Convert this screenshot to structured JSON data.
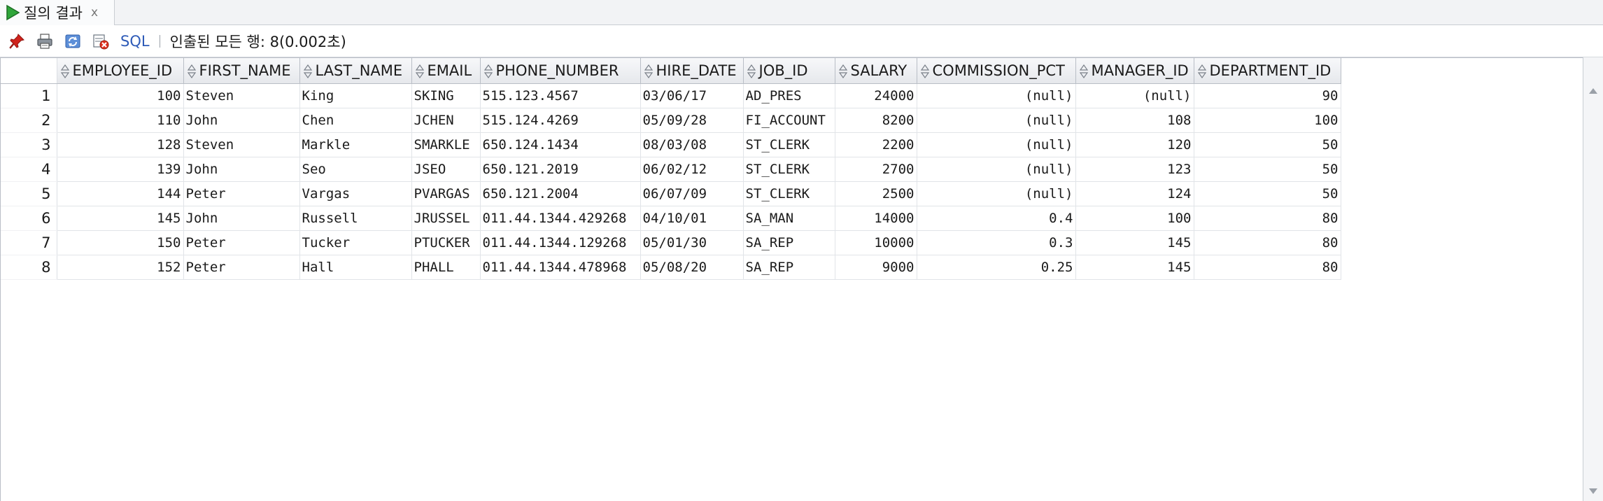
{
  "tab": {
    "label": "질의 결과",
    "close": "x",
    "icon": "run-icon"
  },
  "toolbar": {
    "icons": [
      "pin-icon",
      "print-icon",
      "refresh-icon",
      "cancel-icon"
    ],
    "sql_label": "SQL",
    "status": "인출된 모든 행: 8(0.002초)"
  },
  "grid": {
    "columns": [
      {
        "label": "EMPLOYEE_ID",
        "align": "num"
      },
      {
        "label": "FIRST_NAME",
        "align": "txt"
      },
      {
        "label": "LAST_NAME",
        "align": "txt"
      },
      {
        "label": "EMAIL",
        "align": "txt"
      },
      {
        "label": "PHONE_NUMBER",
        "align": "txt"
      },
      {
        "label": "HIRE_DATE",
        "align": "txt"
      },
      {
        "label": "JOB_ID",
        "align": "txt"
      },
      {
        "label": "SALARY",
        "align": "num"
      },
      {
        "label": "COMMISSION_PCT",
        "align": "num"
      },
      {
        "label": "MANAGER_ID",
        "align": "num"
      },
      {
        "label": "DEPARTMENT_ID",
        "align": "num"
      }
    ],
    "rows": [
      {
        "n": "1",
        "cells": [
          "100",
          "Steven",
          "King",
          "SKING",
          "515.123.4567",
          "03/06/17",
          "AD_PRES",
          "24000",
          "(null)",
          "(null)",
          "90"
        ]
      },
      {
        "n": "2",
        "cells": [
          "110",
          "John",
          "Chen",
          "JCHEN",
          "515.124.4269",
          "05/09/28",
          "FI_ACCOUNT",
          "8200",
          "(null)",
          "108",
          "100"
        ]
      },
      {
        "n": "3",
        "cells": [
          "128",
          "Steven",
          "Markle",
          "SMARKLE",
          "650.124.1434",
          "08/03/08",
          "ST_CLERK",
          "2200",
          "(null)",
          "120",
          "50"
        ]
      },
      {
        "n": "4",
        "cells": [
          "139",
          "John",
          "Seo",
          "JSEO",
          "650.121.2019",
          "06/02/12",
          "ST_CLERK",
          "2700",
          "(null)",
          "123",
          "50"
        ]
      },
      {
        "n": "5",
        "cells": [
          "144",
          "Peter",
          "Vargas",
          "PVARGAS",
          "650.121.2004",
          "06/07/09",
          "ST_CLERK",
          "2500",
          "(null)",
          "124",
          "50"
        ]
      },
      {
        "n": "6",
        "cells": [
          "145",
          "John",
          "Russell",
          "JRUSSEL",
          "011.44.1344.429268",
          "04/10/01",
          "SA_MAN",
          "14000",
          "0.4",
          "100",
          "80"
        ]
      },
      {
        "n": "7",
        "cells": [
          "150",
          "Peter",
          "Tucker",
          "PTUCKER",
          "011.44.1344.129268",
          "05/01/30",
          "SA_REP",
          "10000",
          "0.3",
          "145",
          "80"
        ]
      },
      {
        "n": "8",
        "cells": [
          "152",
          "Peter",
          "Hall",
          "PHALL",
          "011.44.1344.478968",
          "05/08/20",
          "SA_REP",
          "9000",
          "0.25",
          "145",
          "80"
        ]
      }
    ]
  }
}
